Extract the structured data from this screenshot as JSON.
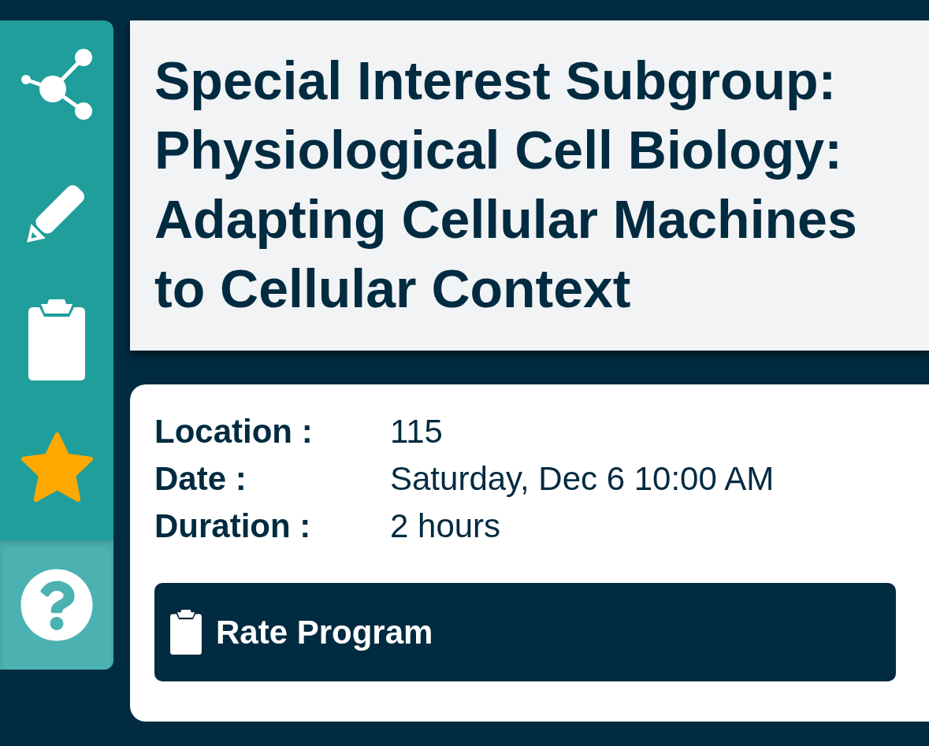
{
  "sidebar": {
    "items": [
      {
        "kind": "share",
        "selected": false
      },
      {
        "kind": "edit",
        "selected": false
      },
      {
        "kind": "notes",
        "selected": false
      },
      {
        "kind": "favorite",
        "selected": false,
        "on": true
      },
      {
        "kind": "help",
        "selected": true
      }
    ]
  },
  "title": "Special Interest Subgroup: Physiological Cell Biology: Adapting Cellular Machines to Cellular Context",
  "details": {
    "rows": [
      {
        "label": "Location :",
        "value": "115"
      },
      {
        "label": "Date :",
        "value": "Saturday, Dec 6 10:00 AM"
      },
      {
        "label": "Duration :",
        "value": "2 hours"
      }
    ],
    "rate_button": {
      "label": "Rate Program"
    }
  }
}
